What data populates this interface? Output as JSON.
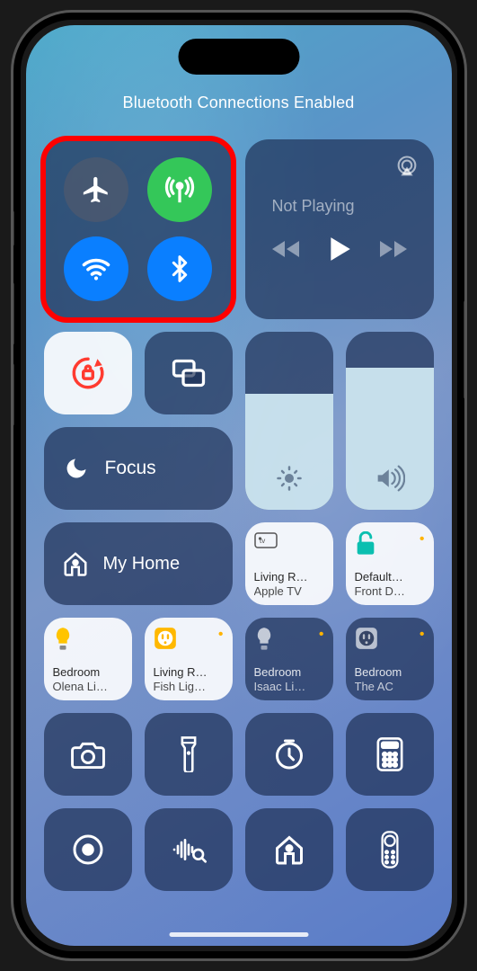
{
  "header": {
    "title": "Bluetooth Connections Enabled"
  },
  "connectivity": {
    "airplane": {
      "active": false,
      "color_off": "rgba(80,90,110,0.7)"
    },
    "cellular": {
      "active": true,
      "color_on": "#34c759"
    },
    "wifi": {
      "active": true,
      "color_on": "#0a7fff"
    },
    "bluetooth": {
      "active": true,
      "color_on": "#0a7fff"
    }
  },
  "media": {
    "status": "Not Playing"
  },
  "focus": {
    "label": "Focus"
  },
  "brightness": {
    "percent": 65
  },
  "volume": {
    "percent": 80
  },
  "home": {
    "label": "My Home"
  },
  "devices": {
    "tv": {
      "title": "Living R…",
      "sub": "Apple TV"
    },
    "lock": {
      "title": "Default…",
      "sub": "Front D…"
    },
    "bulb1": {
      "title": "Bedroom",
      "sub": "Olena Li…"
    },
    "bulb2": {
      "title": "Living R…",
      "sub": "Fish Lig…"
    },
    "bulb3": {
      "title": "Bedroom",
      "sub": "Isaac Li…"
    },
    "plug": {
      "title": "Bedroom",
      "sub": "The AC"
    }
  },
  "colors": {
    "accent_red": "#ff3b30",
    "tile_dark": "rgba(28,46,82,0.68)",
    "tile_light": "rgba(255,255,255,0.9)"
  },
  "icons": {
    "airplane": "airplane-icon",
    "cellular": "antenna-icon",
    "wifi": "wifi-icon",
    "bluetooth": "bluetooth-icon",
    "airplay": "airplay-icon",
    "prev": "backward-icon",
    "play": "play-icon",
    "next": "forward-icon",
    "lock_rotate": "rotation-lock-icon",
    "mirror": "screen-mirror-icon",
    "moon": "moon-icon",
    "bright": "sun-icon",
    "vol": "speaker-icon",
    "house": "house-icon",
    "appletv": "appletv-icon",
    "padlock": "padlock-icon",
    "bulb": "lightbulb-icon",
    "outlet": "outlet-icon",
    "camera": "camera-icon",
    "flash": "flashlight-icon",
    "timer": "timer-icon",
    "calc": "calculator-icon",
    "record": "screen-record-icon",
    "shazam": "sound-recognition-icon",
    "home2": "home-icon",
    "remote": "tv-remote-icon"
  }
}
